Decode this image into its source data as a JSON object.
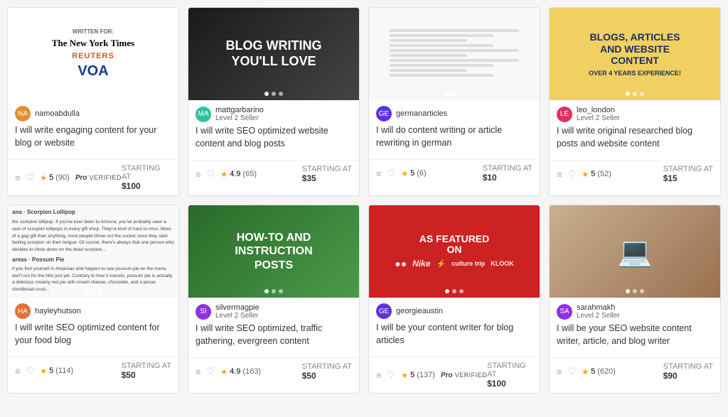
{
  "cards": [
    {
      "id": "card-1",
      "seller": "namoabdulla",
      "level": "",
      "title": "I will write engaging content for your blog or website",
      "rating": "5",
      "reviews": "90",
      "pro": true,
      "price": "$100",
      "imageType": "written-for"
    },
    {
      "id": "card-2",
      "seller": "mattgarbarino",
      "level": "Level 2 Seller",
      "title": "I will write SEO optimized website content and blog posts",
      "rating": "4.9",
      "reviews": "65",
      "pro": false,
      "price": "$35",
      "imageType": "blog-writing"
    },
    {
      "id": "card-3",
      "seller": "germanarticles",
      "level": "",
      "title": "I will do content writing or article rewriting in german",
      "rating": "5",
      "reviews": "6",
      "pro": false,
      "price": "$10",
      "imageType": "document"
    },
    {
      "id": "card-4",
      "seller": "leo_london",
      "level": "Level 2 Seller",
      "title": "I will write original researched blog posts and website content",
      "rating": "5",
      "reviews": "52",
      "pro": false,
      "price": "$15",
      "imageType": "articles"
    },
    {
      "id": "card-5",
      "seller": "hayleyhutson",
      "level": "",
      "title": "I will write SEO optimized content for your food blog",
      "rating": "5",
      "reviews": "114",
      "pro": false,
      "price": "$50",
      "imageType": "food-blog"
    },
    {
      "id": "card-6",
      "seller": "silvermagpie",
      "level": "Level 2 Seller",
      "title": "I will write SEO optimized, traffic gathering, evergreen content",
      "rating": "4.9",
      "reviews": "163",
      "pro": false,
      "price": "$50",
      "imageType": "howto"
    },
    {
      "id": "card-7",
      "seller": "georgieaustin",
      "level": "",
      "title": "I will be your content writer for blog articles",
      "rating": "5",
      "reviews": "137",
      "pro": true,
      "price": "$100",
      "imageType": "featured"
    },
    {
      "id": "card-8",
      "seller": "sarahmakh",
      "level": "Level 2 Seller",
      "title": "I will be your SEO website content writer, article, and blog writer",
      "rating": "5",
      "reviews": "620",
      "pro": false,
      "price": "$90",
      "imageType": "laptop"
    }
  ],
  "labels": {
    "starting_at": "STARTING AT",
    "pro": "Pro",
    "verified": "VERIFIED"
  }
}
